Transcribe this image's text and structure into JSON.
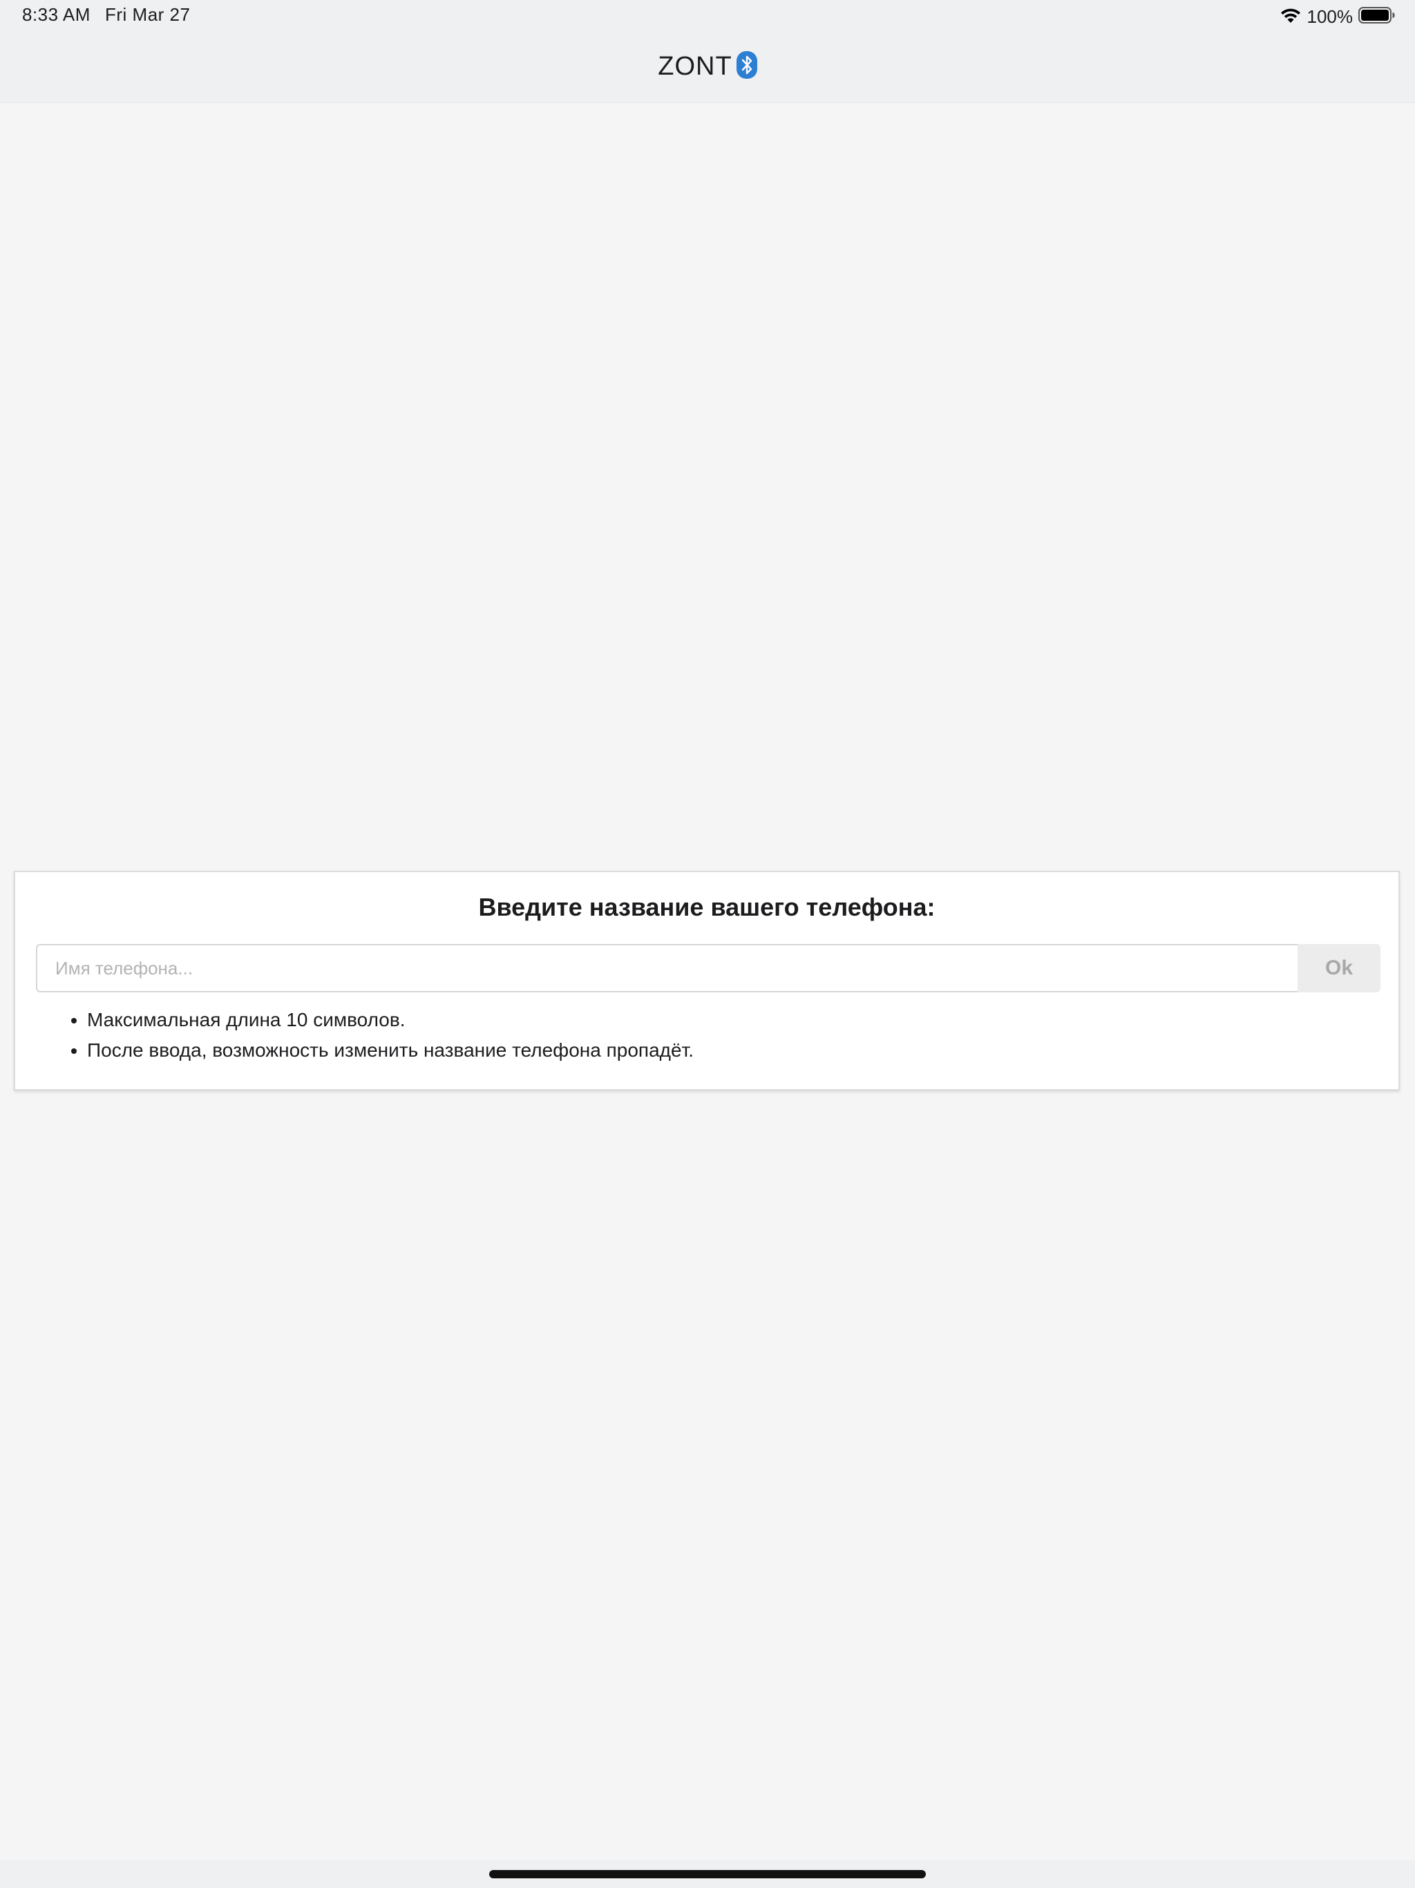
{
  "status_bar": {
    "time": "8:33 AM",
    "date": "Fri Mar 27",
    "battery_percent": "100%",
    "battery_level": 1.0,
    "icons": [
      "wifi-icon",
      "battery-icon"
    ]
  },
  "nav": {
    "brand": "ZONT",
    "brand_icon": "bluetooth-icon",
    "brand_icon_color": "#2d7fd3"
  },
  "dialog": {
    "title": "Введите название вашего телефона:",
    "input_placeholder": "Имя телефона...",
    "input_value": "",
    "ok_label": "Ok",
    "rules": [
      "Максимальная длина 10 символов.",
      "После ввода, возможность изменить название телефона пропадёт."
    ]
  },
  "colors": {
    "background": "#f5f5f5",
    "bar": "#eff0f2",
    "accent": "#2d7fd3",
    "button_bg": "#ececec",
    "button_text": "#a8a8a8"
  }
}
